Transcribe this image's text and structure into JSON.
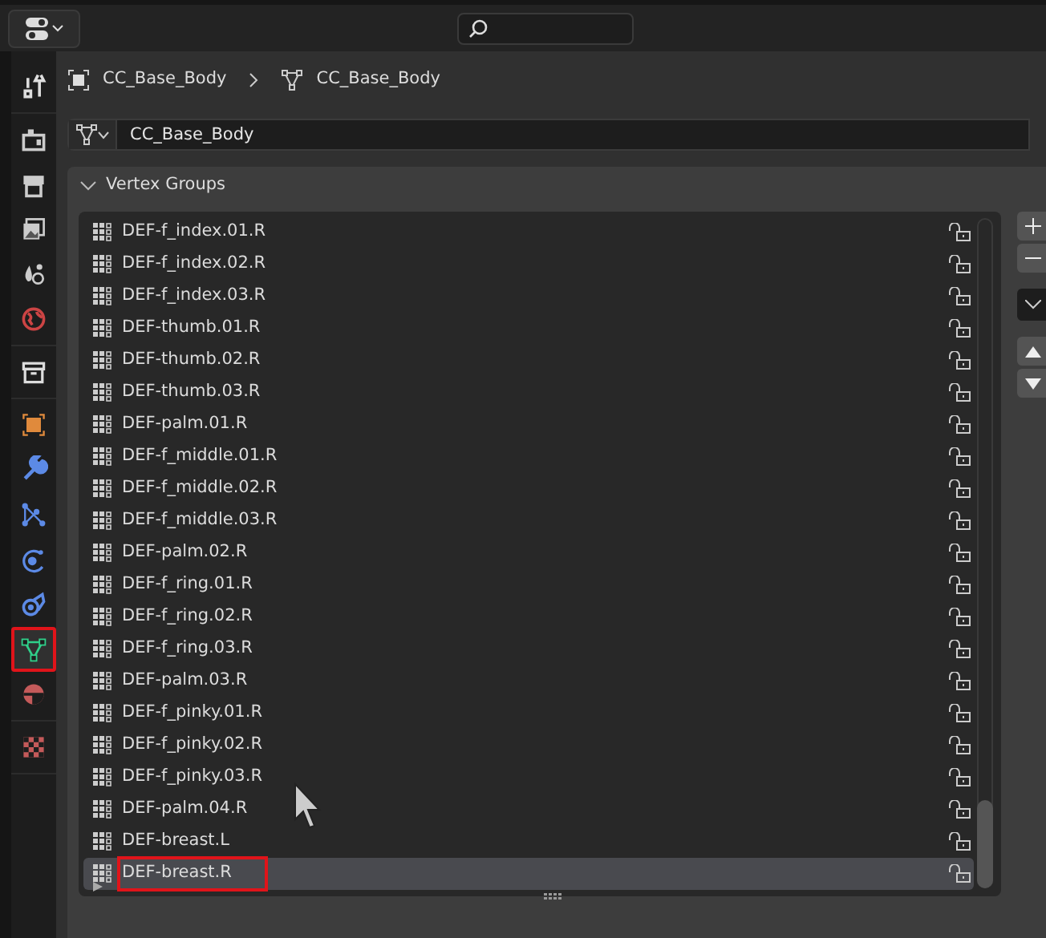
{
  "tab_groups": [
    [
      {
        "kind": "tool",
        "selected": false,
        "highlighted": false
      }
    ],
    [
      {
        "kind": "render",
        "selected": false,
        "highlighted": false
      },
      {
        "kind": "output",
        "selected": false,
        "highlighted": false
      },
      {
        "kind": "view_layer",
        "selected": false,
        "highlighted": false
      },
      {
        "kind": "scene",
        "selected": false,
        "highlighted": false
      },
      {
        "kind": "world",
        "selected": false,
        "highlighted": false
      }
    ],
    [
      {
        "kind": "collection",
        "selected": false,
        "highlighted": false
      }
    ],
    [
      {
        "kind": "object",
        "selected": false,
        "highlighted": false
      },
      {
        "kind": "modifiers",
        "selected": false,
        "highlighted": false
      },
      {
        "kind": "particles",
        "selected": false,
        "highlighted": false
      },
      {
        "kind": "physics",
        "selected": false,
        "highlighted": false
      },
      {
        "kind": "constraints",
        "selected": false,
        "highlighted": false
      },
      {
        "kind": "data",
        "selected": true,
        "highlighted": true
      },
      {
        "kind": "material",
        "selected": false,
        "highlighted": false
      }
    ],
    [
      {
        "kind": "texture",
        "selected": false,
        "highlighted": false
      }
    ]
  ],
  "breadcrumb": [
    {
      "kind": "object",
      "label": "CC_Base_Body"
    },
    {
      "kind": "mesh",
      "label": "CC_Base_Body"
    }
  ],
  "data_field": {
    "value": "CC_Base_Body"
  },
  "panel": {
    "title": "Vertex Groups",
    "expanded": true
  },
  "vertex_groups": [
    {
      "name": "DEF-f_index.01.R",
      "selected": false,
      "locked": false,
      "highlighted": false
    },
    {
      "name": "DEF-f_index.02.R",
      "selected": false,
      "locked": false,
      "highlighted": false
    },
    {
      "name": "DEF-f_index.03.R",
      "selected": false,
      "locked": false,
      "highlighted": false
    },
    {
      "name": "DEF-thumb.01.R",
      "selected": false,
      "locked": false,
      "highlighted": false
    },
    {
      "name": "DEF-thumb.02.R",
      "selected": false,
      "locked": false,
      "highlighted": false
    },
    {
      "name": "DEF-thumb.03.R",
      "selected": false,
      "locked": false,
      "highlighted": false
    },
    {
      "name": "DEF-palm.01.R",
      "selected": false,
      "locked": false,
      "highlighted": false
    },
    {
      "name": "DEF-f_middle.01.R",
      "selected": false,
      "locked": false,
      "highlighted": false
    },
    {
      "name": "DEF-f_middle.02.R",
      "selected": false,
      "locked": false,
      "highlighted": false
    },
    {
      "name": "DEF-f_middle.03.R",
      "selected": false,
      "locked": false,
      "highlighted": false
    },
    {
      "name": "DEF-palm.02.R",
      "selected": false,
      "locked": false,
      "highlighted": false
    },
    {
      "name": "DEF-f_ring.01.R",
      "selected": false,
      "locked": false,
      "highlighted": false
    },
    {
      "name": "DEF-f_ring.02.R",
      "selected": false,
      "locked": false,
      "highlighted": false
    },
    {
      "name": "DEF-f_ring.03.R",
      "selected": false,
      "locked": false,
      "highlighted": false
    },
    {
      "name": "DEF-palm.03.R",
      "selected": false,
      "locked": false,
      "highlighted": false
    },
    {
      "name": "DEF-f_pinky.01.R",
      "selected": false,
      "locked": false,
      "highlighted": false
    },
    {
      "name": "DEF-f_pinky.02.R",
      "selected": false,
      "locked": false,
      "highlighted": false
    },
    {
      "name": "DEF-f_pinky.03.R",
      "selected": false,
      "locked": false,
      "highlighted": false
    },
    {
      "name": "DEF-palm.04.R",
      "selected": false,
      "locked": false,
      "highlighted": false
    },
    {
      "name": "DEF-breast.L",
      "selected": false,
      "locked": false,
      "highlighted": false
    },
    {
      "name": "DEF-breast.R",
      "selected": true,
      "locked": false,
      "highlighted": true
    }
  ]
}
